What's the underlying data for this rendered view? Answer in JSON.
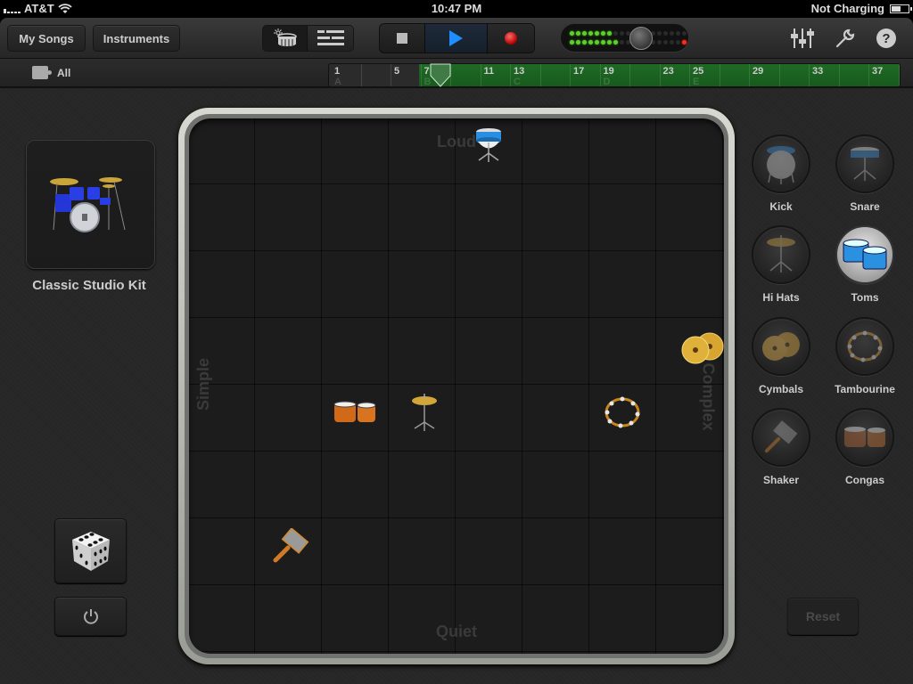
{
  "status_bar": {
    "carrier": "AT&T",
    "time": "10:47 PM",
    "charging_status": "Not Charging",
    "battery_level_pct": 55
  },
  "toolbar": {
    "my_songs_label": "My Songs",
    "instruments_label": "Instruments",
    "view_toggle": [
      {
        "icon": "drummer-view-icon",
        "selected": true
      },
      {
        "icon": "tracks-view-icon",
        "selected": false
      }
    ],
    "transport": {
      "stop_icon": "stop-icon",
      "play_icon": "play-icon",
      "record_icon": "record-icon",
      "playing": true
    },
    "level_meter": {
      "top_row_lit": 7,
      "bottom_row_lit": 8,
      "clip_indicator": true,
      "master_volume_knob": "volume-knob"
    },
    "right_icons": [
      "mixer-icon",
      "settings-wrench-icon",
      "help-icon"
    ],
    "help_label": "?"
  },
  "timeline": {
    "filter_label": "All",
    "bar_numbers": [
      "1",
      "5",
      "7",
      "11",
      "13",
      "17",
      "19",
      "23",
      "25",
      "29",
      "33",
      "37"
    ],
    "sections": [
      "A",
      "B",
      "C",
      "D",
      "E"
    ],
    "playhead_bar": 8
  },
  "left_panel": {
    "kit_name": "Classic Studio Kit",
    "dice_button": "randomize-dice-icon",
    "power_button": "power-icon"
  },
  "xy_pad": {
    "labels": {
      "top": "Loud",
      "bottom": "Quiet",
      "left": "Simple",
      "right": "Complex"
    },
    "pucks": [
      {
        "name": "Snare",
        "x_complexity": 0.56,
        "y_loudness": 0.95
      },
      {
        "name": "Cymbals",
        "x_complexity": 0.96,
        "y_loudness": 0.57
      },
      {
        "name": "Congas",
        "x_complexity": 0.31,
        "y_loudness": 0.45
      },
      {
        "name": "Hi Hats",
        "x_complexity": 0.44,
        "y_loudness": 0.45
      },
      {
        "name": "Tambourine",
        "x_complexity": 0.81,
        "y_loudness": 0.45
      },
      {
        "name": "Shaker",
        "x_complexity": 0.19,
        "y_loudness": 0.2
      }
    ]
  },
  "instruments": [
    {
      "label": "Kick",
      "active": false,
      "icon": "kick-drum-icon"
    },
    {
      "label": "Snare",
      "active": false,
      "icon": "snare-drum-icon"
    },
    {
      "label": "Hi Hats",
      "active": false,
      "icon": "hi-hat-icon"
    },
    {
      "label": "Toms",
      "active": true,
      "icon": "toms-icon"
    },
    {
      "label": "Cymbals",
      "active": false,
      "icon": "cymbals-icon"
    },
    {
      "label": "Tambourine",
      "active": false,
      "icon": "tambourine-icon"
    },
    {
      "label": "Shaker",
      "active": false,
      "icon": "shaker-icon"
    },
    {
      "label": "Congas",
      "active": false,
      "icon": "congas-icon"
    }
  ],
  "reset_label": "Reset",
  "colors": {
    "play_accent": "#1e8dff",
    "region_green": "#1f6a25",
    "meter_green": "#5bd12a",
    "meter_red": "#ff2a1a"
  }
}
